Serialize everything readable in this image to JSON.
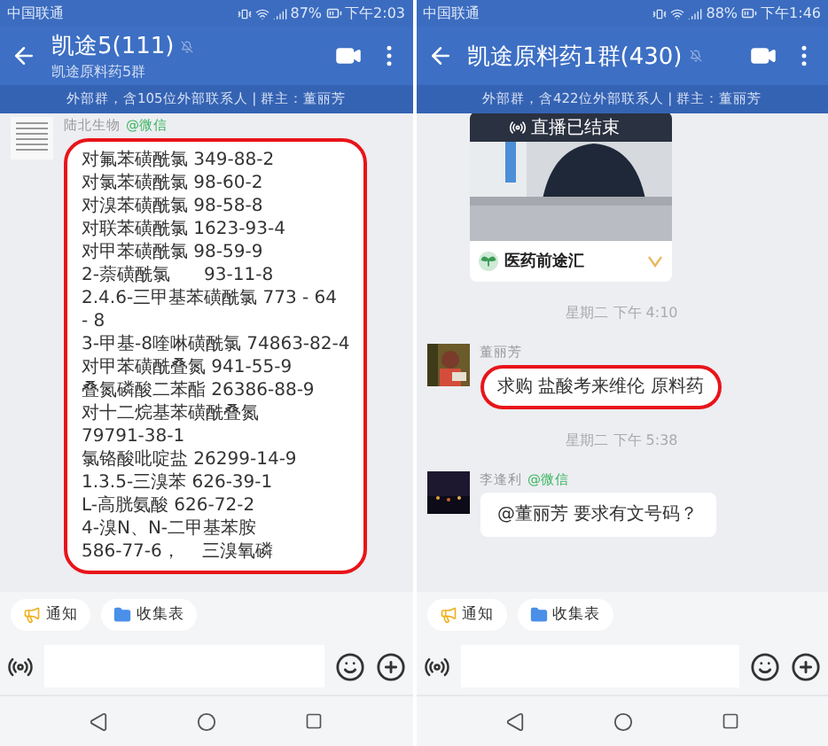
{
  "screens": [
    {
      "status_bar": {
        "carrier": "中国联通",
        "battery": "87%",
        "time": "下午2:03"
      },
      "header": {
        "title": "凯途5(111)",
        "subtitle": "凯途原料药5群"
      },
      "info_bar": "外部群，含105位外部联系人 | 群主：董丽芳",
      "messages": [
        {
          "kind": "text",
          "sender": "陆北生物",
          "sender_tag": "@微信",
          "highlighted": true,
          "lines": [
            "对氟苯磺酰氯 349-88-2",
            "对氯苯磺酰氯 98-60-2",
            "对溴苯磺酰氯 98-58-8",
            "对联苯磺酰氯 1623-93-4",
            "对甲苯磺酰氯 98-59-9",
            "2-萘磺酰氯      93-11-8",
            "2.4.6-三甲基苯磺酰氯 773 - 64",
            "- 8",
            "3-甲基-8喹啉磺酰氯 74863-82-4",
            "对甲苯磺酰叠氮 941-55-9",
            "叠氮磷酸二苯酯 26386-88-9",
            "对十二烷基苯磺酰叠氮",
            "79791-38-1",
            "氯铬酸吡啶盐 26299-14-9",
            "1.3.5-三溴苯 626-39-1",
            "L-高胱氨酸 626-72-2",
            "4-溴N、N-二甲基苯胺",
            "586-77-6，    三溴氧磷"
          ]
        }
      ],
      "toolbar": [
        "通知",
        "收集表"
      ]
    },
    {
      "status_bar": {
        "carrier": "中国联通",
        "battery": "88%",
        "time": "下午1:46"
      },
      "header": {
        "title": "凯途原料药1群(430)"
      },
      "info_bar": "外部群，含422位外部联系人 | 群主：董丽芳",
      "messages": [
        {
          "kind": "card",
          "overlay": "直播已结束",
          "source": "医药前途汇"
        },
        {
          "kind": "timestamp",
          "text": "星期二  下午 4:10"
        },
        {
          "kind": "text",
          "sender": "董丽芳",
          "highlighted": true,
          "lines": [
            "求购 盐酸考来维伦 原料药"
          ]
        },
        {
          "kind": "timestamp",
          "text": "星期二  下午 5:38"
        },
        {
          "kind": "text",
          "sender": "李逢利",
          "sender_tag": "@微信",
          "highlighted": false,
          "lines": [
            "@董丽芳 要求有文号码？"
          ]
        }
      ],
      "toolbar": [
        "通知",
        "收集表"
      ]
    }
  ]
}
